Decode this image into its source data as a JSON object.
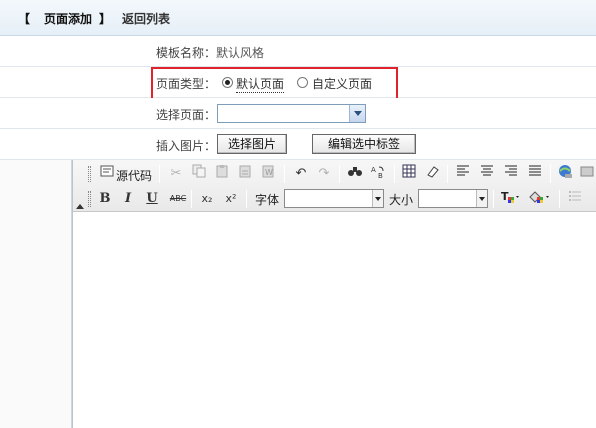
{
  "header": {
    "bracket_left": "【",
    "active_tab": "页面添加",
    "bracket_right": "】",
    "back_link": "返回列表"
  },
  "form": {
    "template": {
      "label": "模板名称：",
      "value": "默认风格"
    },
    "page_type": {
      "label": "页面类型：",
      "options": [
        {
          "label": "默认页面",
          "checked": true
        },
        {
          "label": "自定义页面",
          "checked": false
        }
      ]
    },
    "select_page": {
      "label": "选择页面：",
      "value": ""
    },
    "insert_image": {
      "label": "插入图片：",
      "button": "选择图片"
    },
    "edit_tag_button": "编辑选中标签"
  },
  "editor": {
    "source_label": "源代码",
    "font_label": "字体",
    "size_label": "大小",
    "font_value": "",
    "size_value": "",
    "icons": {
      "source": "source-code-icon",
      "cut": "cut-icon",
      "copy": "copy-icon",
      "paste": "paste-icon",
      "paste_text": "paste-text-icon",
      "paste_word": "paste-word-icon",
      "undo": "undo-icon",
      "redo": "redo-icon",
      "find": "find-icon",
      "replace": "replace-icon",
      "table": "table-icon",
      "eraser": "eraser-icon",
      "align_left": "align-left-icon",
      "align_center": "align-center-icon",
      "align_right": "align-right-icon",
      "justify": "justify-icon",
      "link": "link-icon",
      "bold": "bold-icon",
      "italic": "italic-icon",
      "underline": "underline-icon",
      "strike": "strikethrough-icon",
      "subscript": "subscript-icon",
      "superscript": "superscript-icon",
      "text_color": "text-color-icon",
      "bg_color": "background-color-icon",
      "list": "list-icon"
    },
    "glyphs": {
      "bold": "B",
      "italic": "I",
      "underline": "U",
      "strike": "ABC",
      "subscript": "x₂",
      "superscript": "x²"
    }
  },
  "colors": {
    "highlight": "#e0222a",
    "header_bg": "#e6eff7"
  }
}
